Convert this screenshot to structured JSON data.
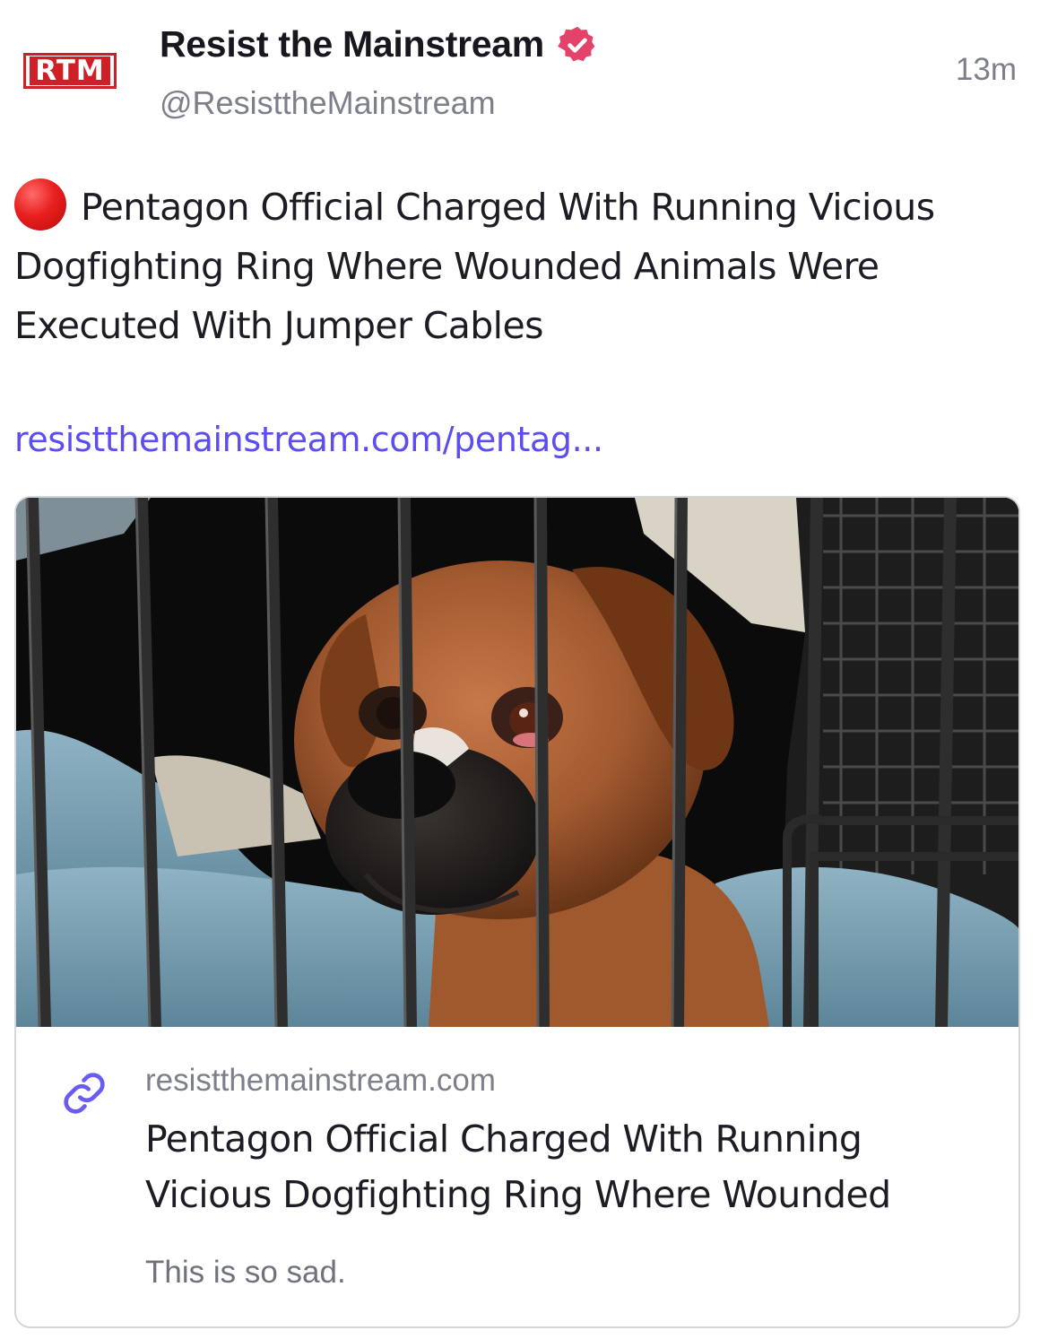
{
  "author": {
    "avatar_text": "RTM",
    "display_name": "Resist the Mainstream",
    "handle": "@ResisttheMainstream",
    "verified_icon": "verified-badge-icon",
    "verified_color": "#e3426a"
  },
  "post": {
    "timestamp": "13m",
    "emoji": "red-circle",
    "text": "Pentagon Official Charged With Running Vicious Dogfighting Ring Where Wounded Animals Were Executed With Jumper Cables",
    "link_text": "resistthemainstream.com/pentag...",
    "link_color": "#5b4df0"
  },
  "card": {
    "image_icon": "boxer-dog-in-cage-image",
    "link_icon": "link-icon",
    "domain": "resistthemainstream.com",
    "title": "Pentagon Official Charged With Running Vicious Dogfighting Ring Where Wounded",
    "description": "This is so sad."
  }
}
